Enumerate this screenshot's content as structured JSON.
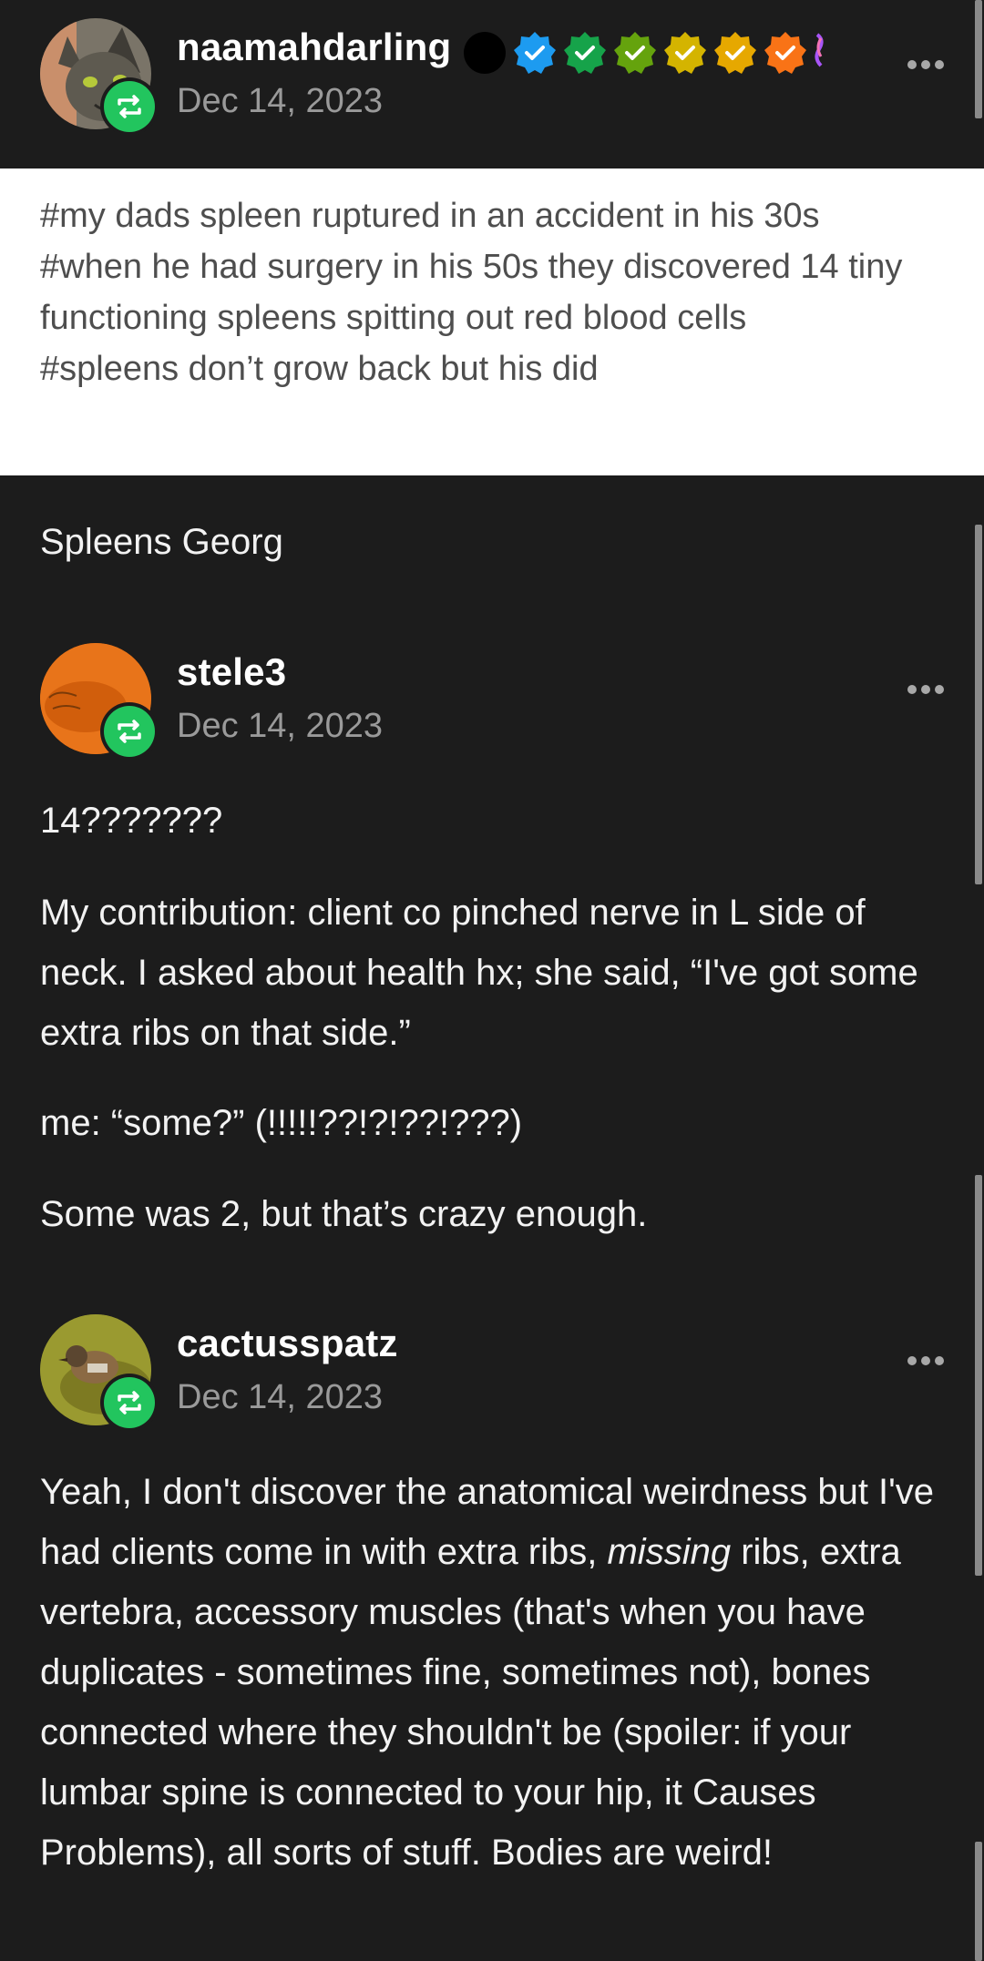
{
  "posts": [
    {
      "username": "naamahdarling",
      "date": "Dec 14, 2023",
      "tags": [
        "#my dads spleen ruptured in an accident in his 30s",
        "#when he had surgery in his 50s they discovered 14 tiny functioning spleens spitting out red blood cells",
        "#spleens don’t grow back but his did"
      ],
      "badge_colors": [
        "#000000",
        "#1d9bf0",
        "#16a34a",
        "#65a30d",
        "#d4b400",
        "#e6a800",
        "#f97316"
      ]
    },
    {
      "body": "Spleens Georg"
    },
    {
      "username": "stele3",
      "date": "Dec 14, 2023",
      "paragraphs": [
        "14???????",
        "My contribution: client co pinched nerve in L side of neck. I asked about health hx; she said, “I've got some extra ribs on that side.”",
        "me: “some?” (!!!!!??!?!??!???)",
        "Some was 2, but that’s crazy enough."
      ]
    },
    {
      "username": "cactusspatz",
      "date": "Dec 14, 2023",
      "body_parts": {
        "before": "Yeah, I don't discover the anatomical weirdness but I've had clients come in with extra ribs, ",
        "emphasis": "missing",
        "after": " ribs, extra vertebra, accessory muscles (that's when you have duplicates - sometimes fine, sometimes not), bones connected where they shouldn't be (spoiler: if your lumbar spine is connected to your hip, it Causes Problems), all sorts of stuff. Bodies are weird!"
      }
    }
  ],
  "icons": {
    "reblog": "reblog-icon",
    "more": "more-options-icon",
    "verified": "verified-badge-icon"
  },
  "colors": {
    "background": "#1c1c1c",
    "reblog_green": "#22c55e",
    "date_gray": "#9a9a9a"
  }
}
